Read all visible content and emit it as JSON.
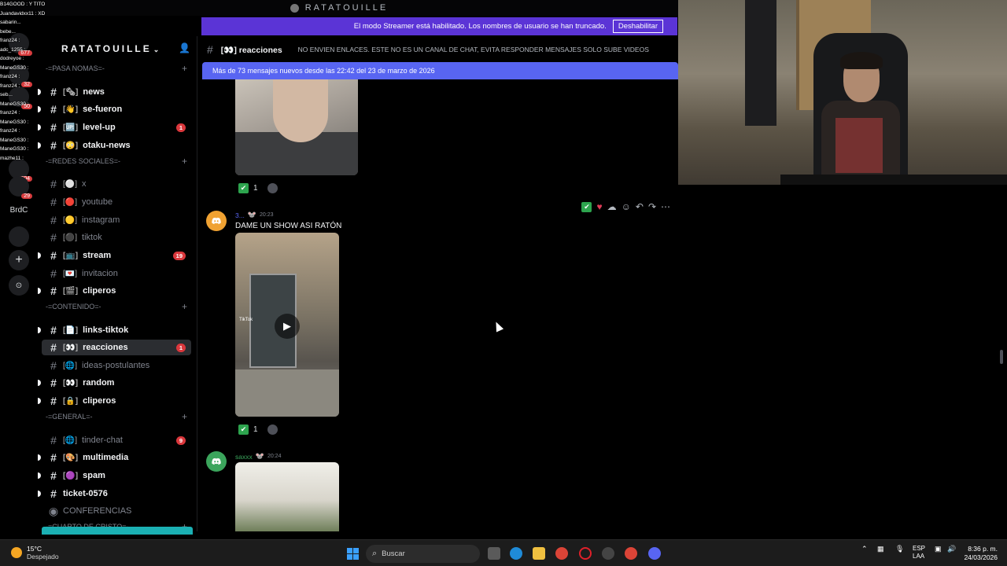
{
  "window": {
    "title": "RATATOUILLE"
  },
  "streamer_banner": {
    "message": "El modo Streamer está habilitado. Los nombres de usuario se han truncado.",
    "button": "Deshabilitar"
  },
  "overlay_chat": [
    "B14GOOD : Y TITO",
    "Juandavidxx11 : XD",
    "sabarin...",
    "bebe...",
    "franz24 :",
    "adc_1255 :",
    "dodreyoe :",
    "ManeGS30 :",
    "franz24 :",
    "franz24 :",
    "seb...",
    "ManeGS30 :",
    "franz24 :",
    "ManeGS30 :",
    "franz24 :",
    "ManeGS30 :",
    "ManeGS30 :",
    "mazhe11 :"
  ],
  "rail": {
    "servers": [
      {
        "label": "",
        "badge": "677"
      },
      {
        "label": "",
        "badge": "32"
      },
      {
        "label": "",
        "badge": "50"
      },
      {
        "label": "",
        "badge": "604"
      },
      {
        "label": "",
        "badge": "29"
      },
      {
        "label": "BrdC",
        "badge": ""
      },
      {
        "label": "",
        "badge": ""
      },
      {
        "label": "+",
        "badge": ""
      },
      {
        "label": "⊙",
        "badge": ""
      }
    ]
  },
  "sidebar": {
    "server_name": "RATATOUILLE",
    "categories": {
      "pasa_nomas": "-=PASA NOMAS=-",
      "redes": "-=REDES SOCIALES=-",
      "contenido": "-=CONTENIDO=-",
      "general": "-=GENERAL=-",
      "cristo": "-=CUARTO DE CRISTO=-"
    },
    "channels": [
      {
        "name": "news",
        "emoji": "[🗞]",
        "bold": true,
        "count": ""
      },
      {
        "name": "se-fueron",
        "emoji": "[👋]",
        "bold": true,
        "count": ""
      },
      {
        "name": "level-up",
        "emoji": "[🆙]",
        "bold": true,
        "count": "1"
      },
      {
        "name": "otaku-news",
        "emoji": "[😳]",
        "bold": true,
        "count": ""
      },
      {
        "name": "x",
        "emoji": "[⚪]",
        "bold": false,
        "count": ""
      },
      {
        "name": "youtube",
        "emoji": "[🔴]",
        "bold": false,
        "count": ""
      },
      {
        "name": "instagram",
        "emoji": "[🟡]",
        "bold": false,
        "count": ""
      },
      {
        "name": "tiktok",
        "emoji": "[⚫]",
        "bold": false,
        "count": ""
      },
      {
        "name": "stream",
        "emoji": "[📺]",
        "bold": true,
        "count": "19"
      },
      {
        "name": "invitacion",
        "emoji": "[💌]",
        "bold": false,
        "count": ""
      },
      {
        "name": "cliperos",
        "emoji": "[🎬]",
        "bold": true,
        "count": ""
      },
      {
        "name": "links-tiktok",
        "emoji": "[📄]",
        "bold": true,
        "count": ""
      },
      {
        "name": "reacciones",
        "emoji": "[👀]",
        "bold": true,
        "count": "1"
      },
      {
        "name": "ideas-postulantes",
        "emoji": "[🌐]",
        "bold": false,
        "count": ""
      },
      {
        "name": "random",
        "emoji": "[👀]",
        "bold": true,
        "count": ""
      },
      {
        "name": "cliperos",
        "emoji": "[🔒]",
        "bold": true,
        "count": ""
      },
      {
        "name": "tinder-chat",
        "emoji": "[🌐]",
        "bold": false,
        "count": "9"
      },
      {
        "name": "multimedia",
        "emoji": "[🎨]",
        "bold": true,
        "count": ""
      },
      {
        "name": "spam",
        "emoji": "[🟣]",
        "bold": true,
        "count": ""
      },
      {
        "name": "ticket-0576",
        "emoji": "",
        "bold": true,
        "count": ""
      },
      {
        "name": "CONFERENCIAS",
        "emoji": "",
        "bold": false,
        "count": ""
      }
    ]
  },
  "channel_header": {
    "emoji": "[👀]",
    "name": "reacciones",
    "topic": "NO ENVIEN ENLACES. ESTE NO ES UN CANAL DE CHAT, EVITA RESPONDER MENSAJES SOLO SUBE VIDEOS"
  },
  "new_messages_bar": "Más de 73 mensajes nuevos desde las 22:42 del 23 de marzo de 2026",
  "messages": [
    {
      "user": "",
      "time": "",
      "text": "",
      "reaction_count": "1"
    },
    {
      "user": "3...",
      "time": "20:23",
      "text": "DAME UN SHOW ASI RATÓN",
      "reaction_count": "1",
      "video_label": "TikTok"
    },
    {
      "user": "saxxx",
      "time": "20:24",
      "text": ""
    }
  ],
  "taskbar": {
    "temp": "15°C",
    "condition": "Despejado",
    "search": "Buscar",
    "lang1": "ESP",
    "lang2": "LAA",
    "time": "8:36 p. m.",
    "date": "24/03/2026"
  },
  "colors": {
    "banner": "#5b34d6",
    "new_messages": "#5865f2",
    "badge": "#da373c",
    "taskbar": "#1c1c1c"
  }
}
